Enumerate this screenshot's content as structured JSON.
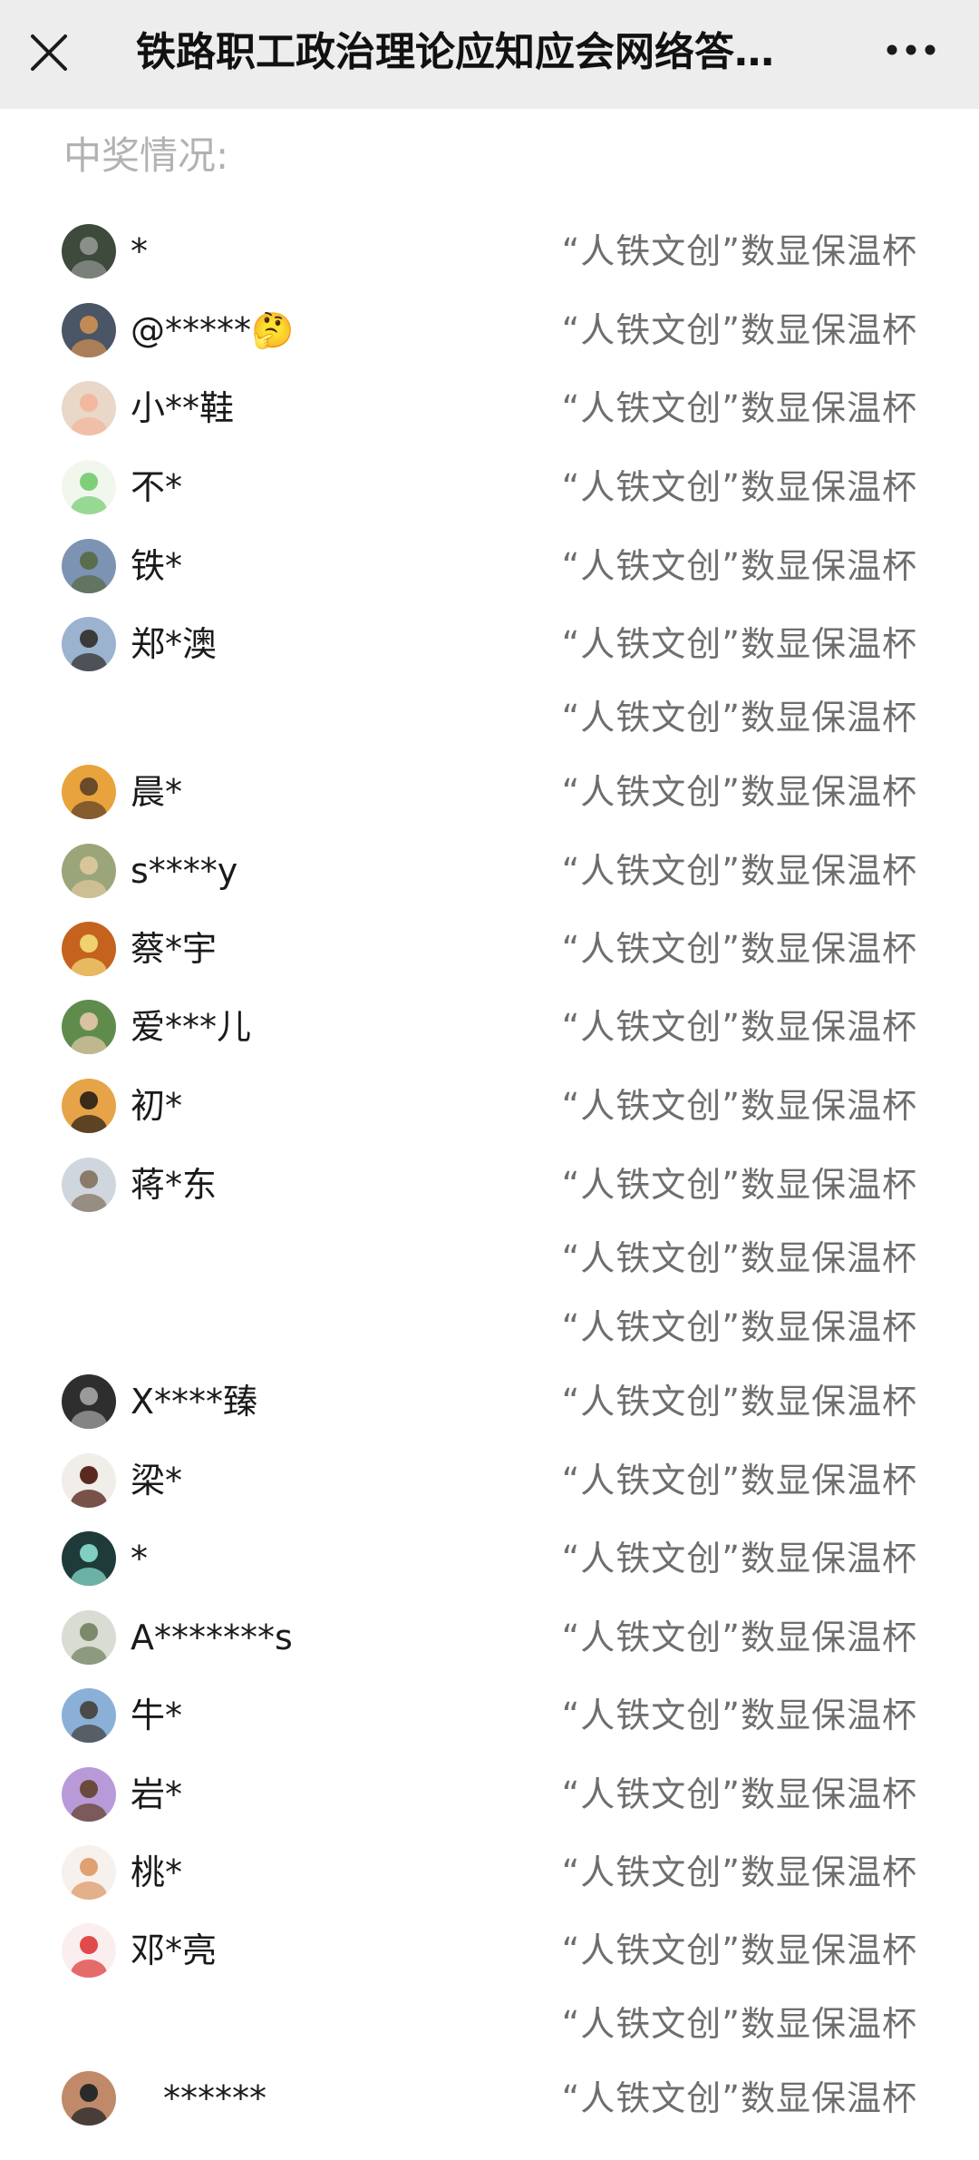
{
  "header": {
    "title": "铁路职工政治理论应知应会网络答…"
  },
  "section_label": "中奖情况:",
  "rows": [
    {
      "name": "*",
      "prize": "“人铁文创”数显保温杯",
      "has_avatar": true,
      "avatar_color": "#3e4a3c",
      "avatar_accent": "#8a8f8a"
    },
    {
      "name": "@*****🤔",
      "prize": "“人铁文创”数显保温杯",
      "has_avatar": true,
      "avatar_color": "#4a5566",
      "avatar_accent": "#c28a55"
    },
    {
      "name": "小**鞋",
      "prize": "“人铁文创”数显保温杯",
      "has_avatar": true,
      "avatar_color": "#e9d7c7",
      "avatar_accent": "#f2b9a0"
    },
    {
      "name": "不*",
      "prize": "“人铁文创”数显保温杯",
      "has_avatar": true,
      "avatar_color": "#f2f7ee",
      "avatar_accent": "#7fcf7a"
    },
    {
      "name": "铁*",
      "prize": "“人铁文创”数显保温杯",
      "has_avatar": true,
      "avatar_color": "#7d93b3",
      "avatar_accent": "#5a6e4e"
    },
    {
      "name": "郑*澳",
      "prize": "“人铁文创”数显保温杯",
      "has_avatar": true,
      "avatar_color": "#9bb3cf",
      "avatar_accent": "#3a3a3a"
    },
    {
      "name": "",
      "prize": "“人铁文创”数显保温杯",
      "has_avatar": false
    },
    {
      "name": "晨*",
      "prize": "“人铁文创”数显保温杯",
      "has_avatar": true,
      "avatar_color": "#e8a33c",
      "avatar_accent": "#6b4a2a"
    },
    {
      "name": "s****y",
      "prize": "“人铁文创”数显保温杯",
      "has_avatar": true,
      "avatar_color": "#9aa67a",
      "avatar_accent": "#d9c59a"
    },
    {
      "name": "蔡*宇",
      "prize": "“人铁文创”数显保温杯",
      "has_avatar": true,
      "avatar_color": "#c4621e",
      "avatar_accent": "#f0d070"
    },
    {
      "name": "爱***儿",
      "prize": "“人铁文创”数显保温杯",
      "has_avatar": true,
      "avatar_color": "#5f8c4d",
      "avatar_accent": "#d7c2a1"
    },
    {
      "name": "初*",
      "prize": "“人铁文创”数显保温杯",
      "has_avatar": true,
      "avatar_color": "#e6a348",
      "avatar_accent": "#3a2a1a"
    },
    {
      "name": "蒋*东",
      "prize": "“人铁文创”数显保温杯",
      "has_avatar": true,
      "avatar_color": "#cfd6de",
      "avatar_accent": "#8a7a6a"
    },
    {
      "name": "",
      "prize": "“人铁文创”数显保温杯",
      "has_avatar": false
    },
    {
      "name": "",
      "prize": "“人铁文创”数显保温杯",
      "has_avatar": false
    },
    {
      "name": "X****臻",
      "prize": "“人铁文创”数显保温杯",
      "has_avatar": true,
      "avatar_color": "#2e2e2e",
      "avatar_accent": "#9a9a9a"
    },
    {
      "name": "梁*",
      "prize": "“人铁文创”数显保温杯",
      "has_avatar": true,
      "avatar_color": "#f1ede8",
      "avatar_accent": "#5a2a20"
    },
    {
      "name": "*",
      "prize": "“人铁文创”数显保温杯",
      "has_avatar": true,
      "avatar_color": "#1e3b3a",
      "avatar_accent": "#7fd0c0"
    },
    {
      "name": "A*******s",
      "prize": "“人铁文创”数显保温杯",
      "has_avatar": true,
      "avatar_color": "#d9dcd3",
      "avatar_accent": "#7a8a6a"
    },
    {
      "name": "牛*",
      "prize": "“人铁文创”数显保温杯",
      "has_avatar": true,
      "avatar_color": "#8ab0d8",
      "avatar_accent": "#4a4a4a"
    },
    {
      "name": "岩*",
      "prize": "“人铁文创”数显保温杯",
      "has_avatar": true,
      "avatar_color": "#b89ad9",
      "avatar_accent": "#6a4a3a"
    },
    {
      "name": "桃*",
      "prize": "“人铁文创”数显保温杯",
      "has_avatar": true,
      "avatar_color": "#f6f1ec",
      "avatar_accent": "#e0a070"
    },
    {
      "name": "邓*亮",
      "prize": "“人铁文创”数显保温杯",
      "has_avatar": true,
      "avatar_color": "#fbeeee",
      "avatar_accent": "#e04a4a"
    },
    {
      "name": "",
      "prize": "“人铁文创”数显保温杯",
      "has_avatar": false
    },
    {
      "name": "******",
      "prize": "“人铁文创”数显保温杯",
      "has_avatar": true,
      "avatar_color": "#c08a6a",
      "avatar_accent": "#2a2a2a"
    }
  ]
}
